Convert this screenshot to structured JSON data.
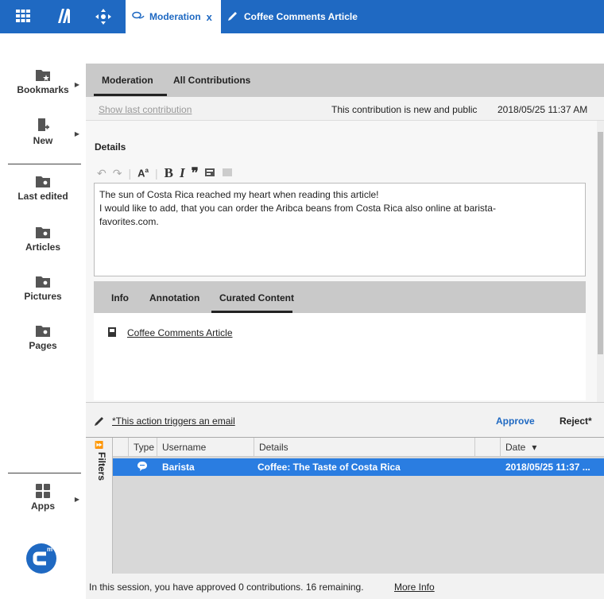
{
  "topbar": {
    "tabs": [
      {
        "label": "Moderation",
        "close": "x"
      },
      {
        "label": "Coffee Comments Article"
      }
    ]
  },
  "sidebar": {
    "items": [
      {
        "label": "Bookmarks"
      },
      {
        "label": "New"
      },
      {
        "label": "Last edited"
      },
      {
        "label": "Articles"
      },
      {
        "label": "Pictures"
      },
      {
        "label": "Pages"
      },
      {
        "label": "Apps"
      }
    ]
  },
  "main": {
    "tabs": [
      {
        "label": "Moderation"
      },
      {
        "label": "All Contributions"
      }
    ],
    "show_last": "Show last contribution",
    "status": "This contribution is new and public",
    "timestamp": "2018/05/25 11:37 AM",
    "details_title": "Details",
    "editor_text_1": "The sun of Costa Rica reached my heart when reading this article!",
    "editor_text_2": "I would like to add, that you can order the Aribca beans from Costa Rica also online at barista-",
    "editor_text_3": "favorites.com.",
    "sub_tabs": [
      {
        "label": "Info"
      },
      {
        "label": "Annotation"
      },
      {
        "label": "Curated Content"
      }
    ],
    "curated_link": "Coffee Comments Article",
    "action_note": "*This action triggers an email",
    "approve": "Approve",
    "reject": "Reject*"
  },
  "grid": {
    "filters_label": "Filters",
    "columns": [
      "Type",
      "Username",
      "Details",
      "Date"
    ],
    "sort_indicator": "▾",
    "rows": [
      {
        "username": "Barista",
        "details": "Coffee: The Taste of Costa Rica",
        "date": "2018/05/25 11:37 ..."
      }
    ]
  },
  "footer": {
    "session_text": "In this session, you have approved 0 contributions. 16 remaining.",
    "more_info": "More Info"
  },
  "colors": {
    "brand_blue": "#1f69c2",
    "row_selected": "#2a7de1",
    "approve": "#1f69c2"
  }
}
